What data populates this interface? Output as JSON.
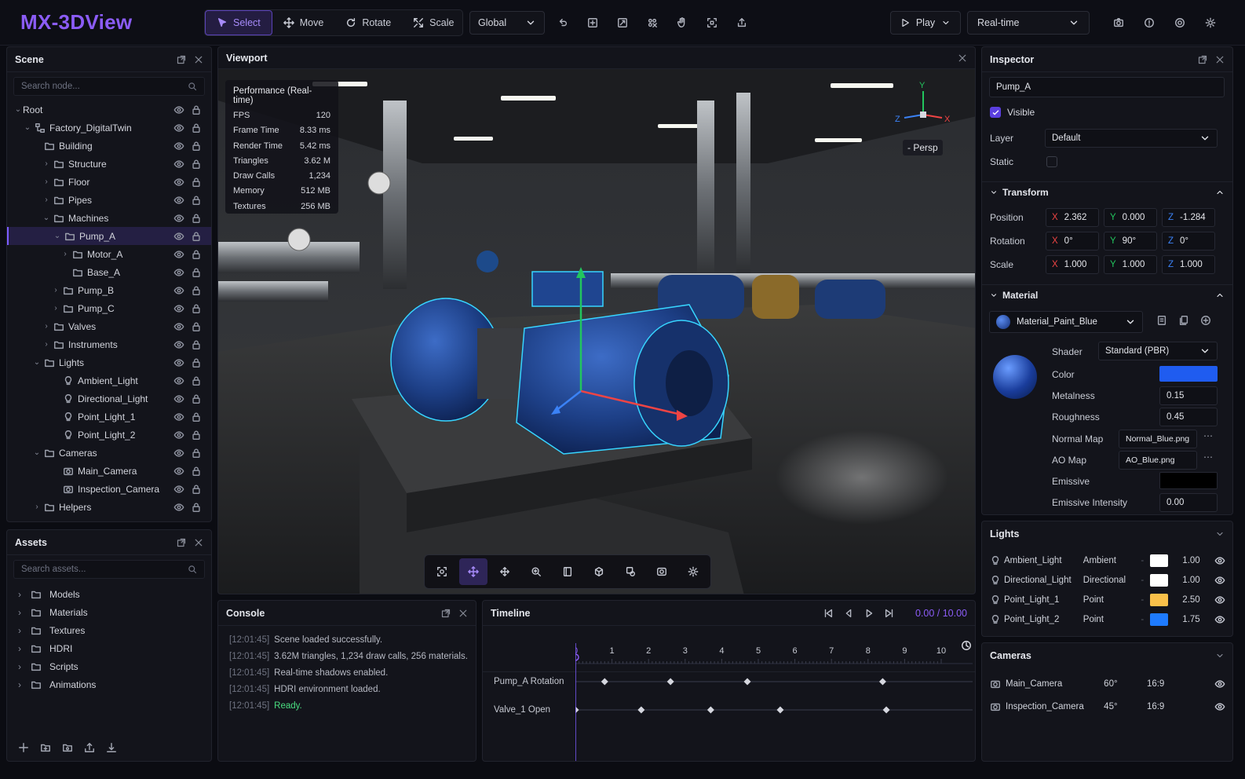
{
  "app": {
    "title": "MX-3DView"
  },
  "toolbar": {
    "tools": [
      {
        "label": "Select",
        "icon": "cursor-icon"
      },
      {
        "label": "Move",
        "icon": "move-icon"
      },
      {
        "label": "Rotate",
        "icon": "rotate-icon"
      },
      {
        "label": "Scale",
        "icon": "scale-icon"
      }
    ],
    "active_tool": "Select",
    "space": "Global",
    "icon_buttons": [
      "undo-icon",
      "frame-icon",
      "snap-icon",
      "grid-icon",
      "hand-icon",
      "transform-icon",
      "export-icon"
    ],
    "play_label": "Play",
    "mode": "Real-time",
    "right_icons": [
      "camera-icon",
      "info-icon",
      "target-icon",
      "gear-icon"
    ]
  },
  "scene_panel": {
    "title": "Scene",
    "search_placeholder": "Search node...",
    "nodes": [
      {
        "label": "Root",
        "depth": 0,
        "chev": "v",
        "icon": "none"
      },
      {
        "label": "Factory_DigitalTwin",
        "depth": 1,
        "chev": "v",
        "icon": "hierarchy-icon"
      },
      {
        "label": "Building",
        "depth": 2,
        "chev": "",
        "icon": "folder-icon"
      },
      {
        "label": "Structure",
        "depth": 3,
        "chev": ">",
        "icon": "folder-icon"
      },
      {
        "label": "Floor",
        "depth": 3,
        "chev": ">",
        "icon": "folder-icon"
      },
      {
        "label": "Pipes",
        "depth": 3,
        "chev": ">",
        "icon": "folder-icon"
      },
      {
        "label": "Machines",
        "depth": 3,
        "chev": "v",
        "icon": "folder-icon"
      },
      {
        "label": "Pump_A",
        "depth": 4,
        "chev": "v",
        "icon": "folder-icon",
        "selected": true
      },
      {
        "label": "Motor_A",
        "depth": 5,
        "chev": ">",
        "icon": "folder-icon"
      },
      {
        "label": "Base_A",
        "depth": 5,
        "chev": "",
        "icon": "folder-icon"
      },
      {
        "label": "Pump_B",
        "depth": 4,
        "chev": ">",
        "icon": "folder-icon"
      },
      {
        "label": "Pump_C",
        "depth": 4,
        "chev": ">",
        "icon": "folder-icon"
      },
      {
        "label": "Valves",
        "depth": 3,
        "chev": ">",
        "icon": "folder-icon"
      },
      {
        "label": "Instruments",
        "depth": 3,
        "chev": ">",
        "icon": "folder-icon"
      },
      {
        "label": "Lights",
        "depth": 2,
        "chev": "v",
        "icon": "folder-icon"
      },
      {
        "label": "Ambient_Light",
        "depth": 4,
        "chev": "",
        "icon": "bulb-icon"
      },
      {
        "label": "Directional_Light",
        "depth": 4,
        "chev": "",
        "icon": "bulb-icon"
      },
      {
        "label": "Point_Light_1",
        "depth": 4,
        "chev": "",
        "icon": "bulb-icon"
      },
      {
        "label": "Point_Light_2",
        "depth": 4,
        "chev": "",
        "icon": "bulb-icon"
      },
      {
        "label": "Cameras",
        "depth": 2,
        "chev": "v",
        "icon": "folder-icon"
      },
      {
        "label": "Main_Camera",
        "depth": 4,
        "chev": "",
        "icon": "camera-icon"
      },
      {
        "label": "Inspection_Camera",
        "depth": 4,
        "chev": "",
        "icon": "camera-icon"
      },
      {
        "label": "Helpers",
        "depth": 2,
        "chev": ">",
        "icon": "folder-icon"
      }
    ]
  },
  "assets_panel": {
    "title": "Assets",
    "search_placeholder": "Search assets...",
    "items": [
      "Models",
      "Materials",
      "Textures",
      "HDRI",
      "Scripts",
      "Animations"
    ],
    "footer_icons": [
      "plus-icon",
      "folder-add-icon",
      "import-icon",
      "upload-icon",
      "download-icon"
    ]
  },
  "viewport": {
    "title": "Viewport",
    "projection": "- Persp",
    "gizmo_axes": {
      "y": "Y",
      "x": "X",
      "z": "Z"
    },
    "performance": {
      "title": "Performance (Real-time)",
      "rows": [
        {
          "label": "FPS",
          "value": "120"
        },
        {
          "label": "Frame Time",
          "value": "8.33 ms"
        },
        {
          "label": "Render Time",
          "value": "5.42 ms"
        },
        {
          "label": "Triangles",
          "value": "3.62 M"
        },
        {
          "label": "Draw Calls",
          "value": "1,234"
        },
        {
          "label": "Memory",
          "value": "512 MB"
        },
        {
          "label": "Textures",
          "value": "256 MB"
        }
      ]
    },
    "tools": [
      "focus-icon",
      "move-icon",
      "pan-icon",
      "zoom-icon",
      "frame-icon",
      "orbit-icon",
      "layers-icon",
      "screenshot-icon",
      "settings-icon"
    ],
    "active_tool_index": 1
  },
  "console": {
    "title": "Console",
    "lines": [
      {
        "time": "[12:01:45]",
        "text": "Scene loaded successfully."
      },
      {
        "time": "[12:01:45]",
        "text": "3.62M triangles, 1,234 draw calls, 256 materials."
      },
      {
        "time": "[12:01:45]",
        "text": "Real-time shadows enabled."
      },
      {
        "time": "[12:01:45]",
        "text": "HDRI environment loaded."
      },
      {
        "time": "[12:01:45]",
        "text": "Ready.",
        "status": "ok"
      }
    ]
  },
  "timeline": {
    "title": "Timeline",
    "time_display": "0.00 / 10.00",
    "ticks": [
      "0",
      "1",
      "2",
      "3",
      "4",
      "5",
      "6",
      "7",
      "8",
      "9",
      "10"
    ],
    "current_time": 0.0,
    "duration": 10.0,
    "tracks": [
      {
        "name": "Pump_A Rotation",
        "keys": [
          0.8,
          2.6,
          4.7,
          8.4
        ]
      },
      {
        "name": "Valve_1 Open",
        "keys": [
          0.0,
          1.8,
          3.7,
          5.6,
          8.5
        ]
      }
    ]
  },
  "inspector": {
    "title": "Inspector",
    "name": "Pump_A",
    "visible_label": "Visible",
    "visible": true,
    "layer_label": "Layer",
    "layer": "Default",
    "static_label": "Static",
    "static": false,
    "transform": {
      "title": "Transform",
      "rows": [
        {
          "label": "Position",
          "x": "2.362",
          "y": "0.000",
          "z": "-1.284"
        },
        {
          "label": "Rotation",
          "x": "0°",
          "y": "90°",
          "z": "0°"
        },
        {
          "label": "Scale",
          "x": "1.000",
          "y": "1.000",
          "z": "1.000"
        }
      ]
    },
    "material": {
      "title": "Material",
      "name": "Material_Paint_Blue",
      "shader_label": "Shader",
      "shader": "Standard (PBR)",
      "color_label": "Color",
      "color": "#1f5cf0",
      "metalness_label": "Metalness",
      "metalness": "0.15",
      "roughness_label": "Roughness",
      "roughness": "0.45",
      "normal_map_label": "Normal Map",
      "normal_map": "Normal_Blue.png",
      "ao_map_label": "AO Map",
      "ao_map": "AO_Blue.png",
      "emissive_label": "Emissive",
      "emissive_color": "#000000",
      "emissive_intensity_label": "Emissive Intensity",
      "emissive_intensity": "0.00"
    }
  },
  "lights_panel": {
    "title": "Lights",
    "items": [
      {
        "name": "Ambient_Light",
        "type": "Ambient",
        "color": "#ffffff",
        "intensity": "1.00"
      },
      {
        "name": "Directional_Light",
        "type": "Directional",
        "color": "#ffffff",
        "intensity": "1.00"
      },
      {
        "name": "Point_Light_1",
        "type": "Point",
        "color": "#f9c04a",
        "intensity": "2.50"
      },
      {
        "name": "Point_Light_2",
        "type": "Point",
        "color": "#1e7bff",
        "intensity": "1.75"
      }
    ]
  },
  "cameras_panel": {
    "title": "Cameras",
    "items": [
      {
        "name": "Main_Camera",
        "fov": "60°",
        "aspect": "16:9"
      },
      {
        "name": "Inspection_Camera",
        "fov": "45°",
        "aspect": "16:9"
      }
    ]
  },
  "colors": {
    "accent": "#8b5cf6",
    "selection": "#241f43",
    "bg": "#0b0c12",
    "panel": "#13141b"
  }
}
